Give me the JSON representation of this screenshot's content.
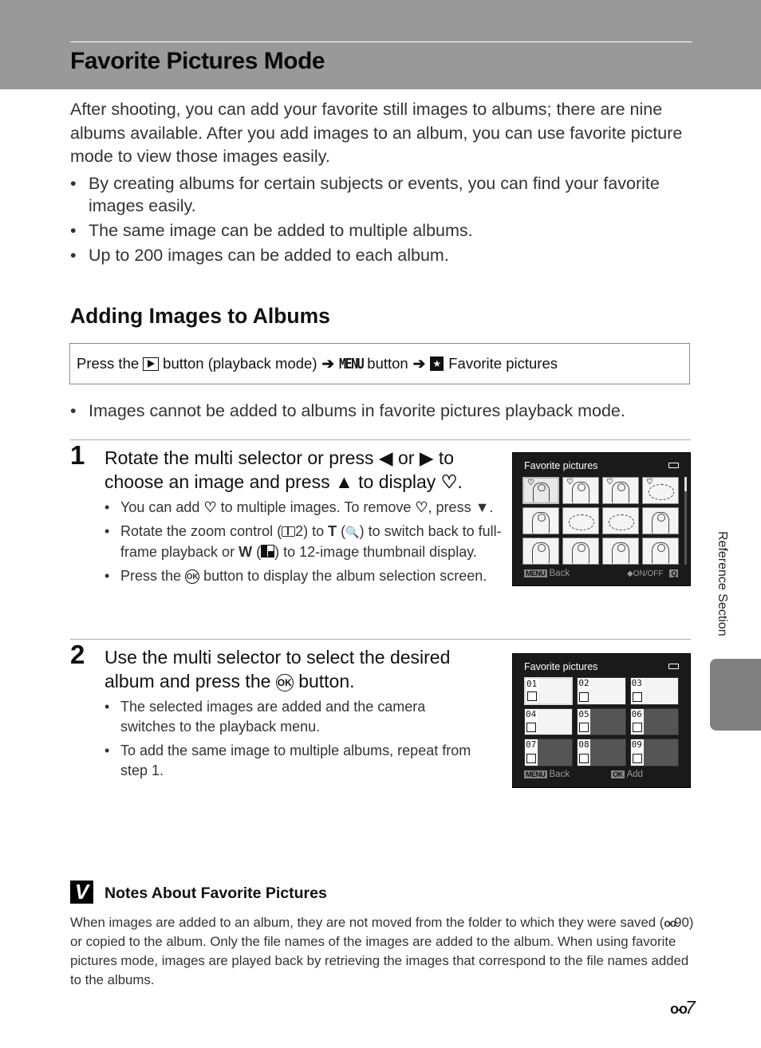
{
  "header": {
    "title": "Favorite Pictures Mode"
  },
  "intro": {
    "paragraph": "After shooting, you can add your favorite still images to albums; there are nine albums available. After you add images to an album, you can use favorite picture mode to view those images easily.",
    "bullets": [
      "By creating albums for certain subjects or events, you can find your favorite images easily.",
      "The same image can be added to multiple albums.",
      "Up to 200 images can be added to each album."
    ]
  },
  "section": {
    "title": "Adding Images to Albums",
    "procedure": {
      "press_the": "Press the",
      "play_button_text": "button (playback mode)",
      "arrow": "➔",
      "menu_label": "MENU",
      "menu_button_text": "button",
      "fav_icon": "★",
      "fav_label": "Favorite pictures"
    },
    "note": "Images cannot be added to albums in favorite pictures playback mode."
  },
  "step1": {
    "number": "1",
    "title_a": "Rotate the multi selector or press",
    "left_arrow": "◀",
    "or": "or",
    "right_arrow": "▶",
    "title_b": "to choose an image and press",
    "up_arrow": "▲",
    "title_c": "to display",
    "heart_icon": "♡",
    "bullets": {
      "b1_a": "You can add",
      "b1_b": "to multiple images. To remove",
      "b1_c": ", press",
      "down_arrow": "▼",
      "b2_a": "Rotate the zoom control (",
      "b2_ref": "2",
      "b2_b": ") to",
      "t_label": "T",
      "b2_c": "(",
      "magnifier": "🔍",
      "b2_d": ") to switch back to full-frame playback or",
      "w_label": "W",
      "b2_e": ") to 12-image thumbnail display.",
      "b3_a": "Press the",
      "ok_label": "OK",
      "b3_b": "button to display the album selection screen."
    },
    "screen": {
      "title": "Favorite pictures",
      "footer_menu": "MENU",
      "footer_back": "Back",
      "footer_onoff": "◆ON/OFF",
      "footer_zoom": "Q",
      "thumbnails": [
        {
          "type": "portrait",
          "favorite": true,
          "selected": true
        },
        {
          "type": "figure",
          "favorite": true
        },
        {
          "type": "figure",
          "favorite": true
        },
        {
          "type": "flower",
          "favorite": true
        },
        {
          "type": "portrait"
        },
        {
          "type": "flower"
        },
        {
          "type": "flower"
        },
        {
          "type": "figure"
        },
        {
          "type": "figure"
        },
        {
          "type": "figure"
        },
        {
          "type": "portrait"
        },
        {
          "type": "portrait"
        }
      ]
    }
  },
  "step2": {
    "number": "2",
    "title_a": "Use the multi selector to select the desired album and press the",
    "ok_label": "OK",
    "title_b": "button.",
    "bullets": [
      "The selected images are added and the camera switches to the playback menu.",
      "To add the same image to multiple albums, repeat from step 1."
    ],
    "screen": {
      "title": "Favorite pictures",
      "footer_menu": "MENU",
      "footer_back": "Back",
      "footer_ok": "OK",
      "footer_add": "Add",
      "albums": [
        {
          "num": "01",
          "has_image": true,
          "selected": true
        },
        {
          "num": "02",
          "has_image": true
        },
        {
          "num": "03",
          "has_image": true
        },
        {
          "num": "04",
          "has_image": true
        },
        {
          "num": "05",
          "has_image": false
        },
        {
          "num": "06",
          "has_image": false
        },
        {
          "num": "07",
          "has_image": false
        },
        {
          "num": "08",
          "has_image": false
        },
        {
          "num": "09",
          "has_image": false
        }
      ]
    }
  },
  "side_tab": {
    "label": "Reference Section"
  },
  "notes": {
    "icon": "V",
    "title": "Notes About Favorite Pictures",
    "body_a": "When images are added to an album, they are not moved from the folder to which they were saved (",
    "ref": "90",
    "body_b": ") or copied to the album. Only the file names of the images are added to the album. When using favorite pictures mode, images are played back by retrieving the images that correspond to the file names added to the albums."
  },
  "footer": {
    "page_number": "7",
    "section_icon": "binoculars"
  }
}
